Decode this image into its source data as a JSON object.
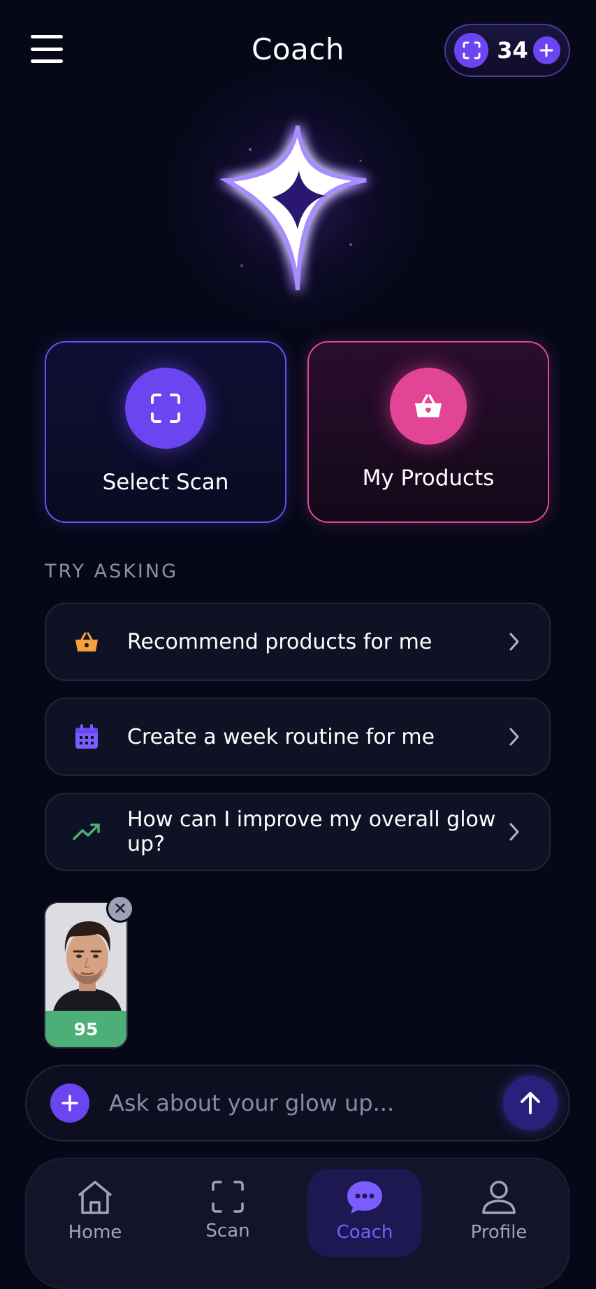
{
  "header": {
    "title": "Coach",
    "credits": {
      "count": "34"
    }
  },
  "cards": [
    {
      "label": "Select Scan",
      "icon": "scan-frame-icon",
      "color": "#6a45f0"
    },
    {
      "label": "My Products",
      "icon": "shopping-basket-icon",
      "color": "#e24496"
    }
  ],
  "try_asking": {
    "label": "TRY ASKING",
    "prompts": [
      {
        "text": "Recommend products for me",
        "icon": "basket-icon",
        "color": "#f5a03a"
      },
      {
        "text": "Create a week routine for me",
        "icon": "calendar-icon",
        "color": "#7b5cff"
      },
      {
        "text": "How can I improve my overall glow up?",
        "icon": "trending-up-icon",
        "color": "#4caf78"
      }
    ]
  },
  "attachment": {
    "score": "95"
  },
  "composer": {
    "placeholder": "Ask about your glow up..."
  },
  "tabbar": {
    "items": [
      {
        "label": "Home",
        "icon": "home-icon"
      },
      {
        "label": "Scan",
        "icon": "scan-icon"
      },
      {
        "label": "Coach",
        "icon": "chat-bubble-icon",
        "active": true
      },
      {
        "label": "Profile",
        "icon": "profile-icon"
      }
    ]
  },
  "colors": {
    "accent": "#6a45f0",
    "pink": "#e24496",
    "background": "#060818"
  }
}
